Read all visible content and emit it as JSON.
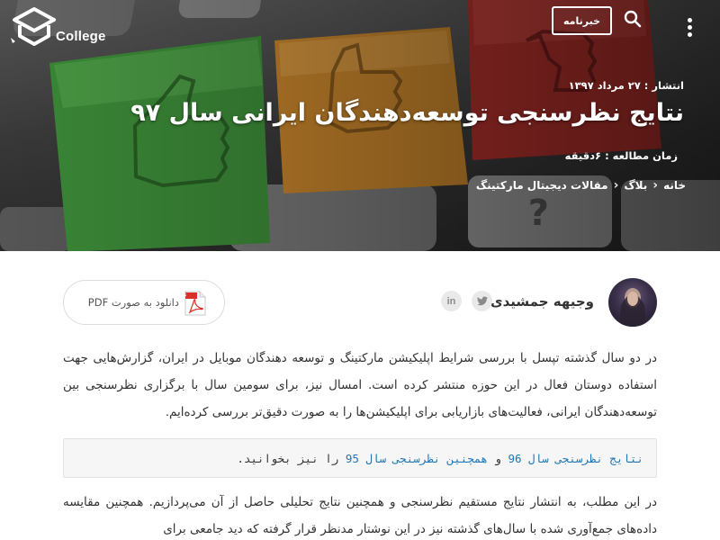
{
  "header": {
    "logo_text": "College",
    "newsletter_label": "خبرنامه"
  },
  "hero": {
    "publish_date": "انتشار : ۲۷ مرداد ۱۳۹۷",
    "title": "نتایج نظرسنجی توسعه‌دهندگان ایرانی سال ۹۷",
    "read_time": "زمان مطالعه : ۶دقیقه",
    "breadcrumb": [
      {
        "label": "خانه"
      },
      {
        "label": "بلاگ"
      },
      {
        "label": "مقالات دیجیتال مارکتینگ"
      }
    ]
  },
  "author": {
    "name": "وجیهه جمشیدی",
    "linkedin_label": "in"
  },
  "pdf": {
    "label": "دانلود به صورت PDF"
  },
  "article": {
    "paragraph1": "در دو سال گذشته تپسل با بررسی شرایط اپلیکیشن مارکتینگ و توسعه دهندگان موبایل در ایران، گزارش‌هایی جهت استفاده دوستان فعال در این حوزه منتشر کرده است. امسال نیز، برای سومین سال با برگزاری نظرسنجی بین توسعه‌دهندگان ایرانی، فعالیت‌های بازاریابی برای اپلیکیشن‌ها را به صورت دقیق‌تر بررسی کرده‌ایم.",
    "note_link1": "نتایج نظرسنجی سال 96",
    "note_and": " و ",
    "note_link2": "همچنین نظرسنجی سال 95",
    "note_tail": " را نیز بخوانید.",
    "paragraph2": "در این مطلب، به انتشار نتایج مستقیم نظرسنجی و همچنین نتایج تحلیلی حاصل از آن می‌پردازیم. همچنین مقایسه داده‌های جمع‌آوری شده با سال‌های گذشته نیز در این نوشتار مدنظر قرار گرفته که دید جامعی برای"
  },
  "colors": {
    "link": "#1f77b4",
    "key_green": "#3e8f3a",
    "key_orange": "#c9862c",
    "key_red": "#b3312c"
  },
  "icons": [
    "logo-mark-icon",
    "menu-dots-icon",
    "search-icon",
    "twitter-icon",
    "linkedin-icon",
    "pdf-file-icon",
    "chevron-left-icon"
  ]
}
